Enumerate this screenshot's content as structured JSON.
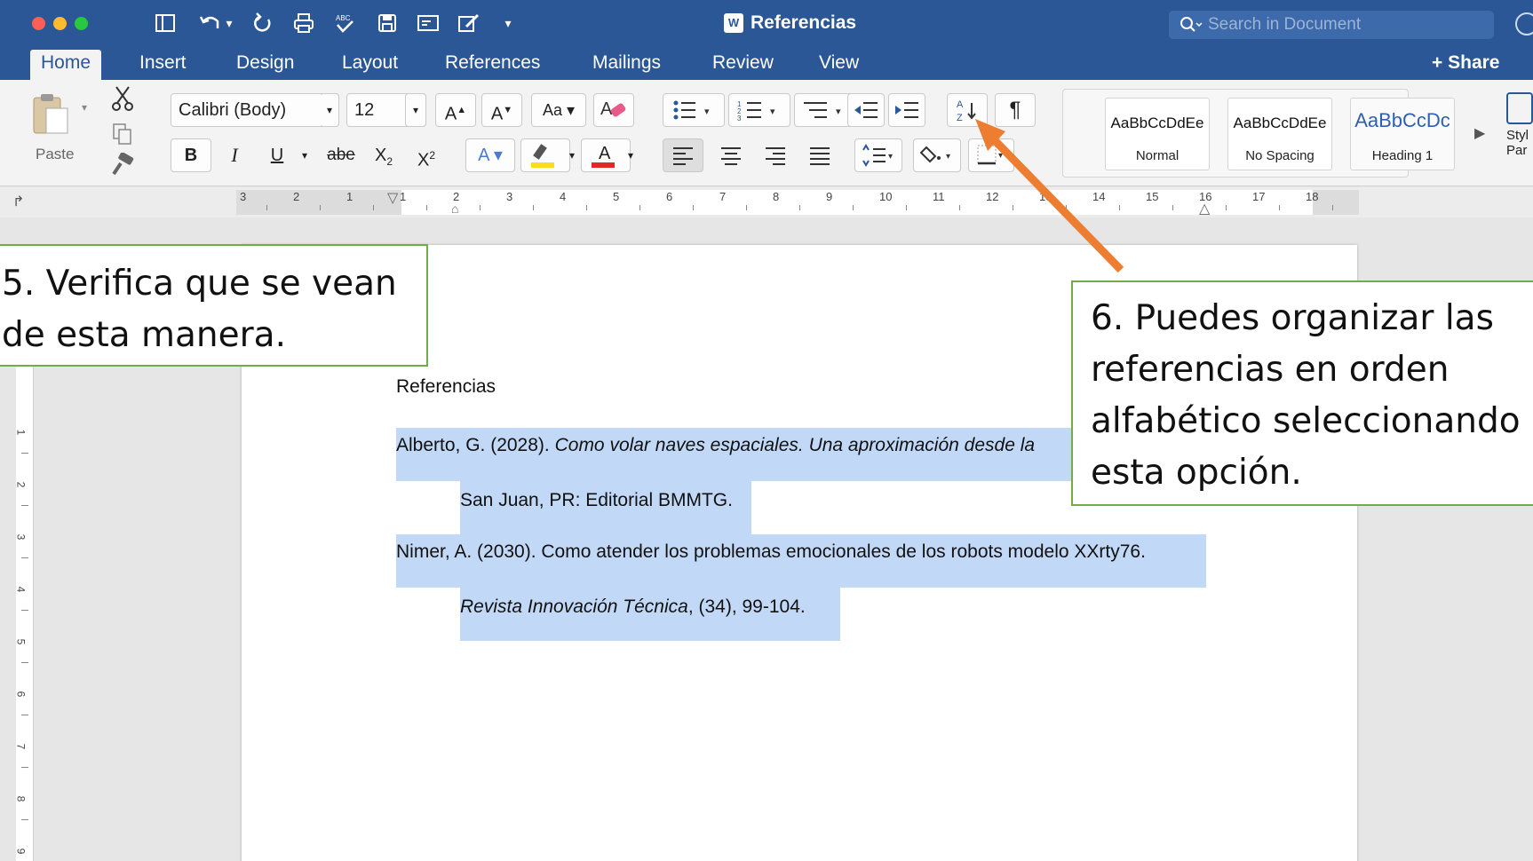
{
  "window": {
    "title": "Referencias",
    "doc_icon_letter": "W",
    "search_placeholder": "Search in Document",
    "share_label": "Share"
  },
  "quick_access": {
    "undo_arrow": "▾",
    "customize": "▾"
  },
  "tabs": [
    "Home",
    "Insert",
    "Design",
    "Layout",
    "References",
    "Mailings",
    "Review",
    "View"
  ],
  "ribbon": {
    "paste_label": "Paste",
    "font_name": "Calibri (Body)",
    "font_size": "12",
    "grow_font": "A",
    "shrink_font": "A",
    "bold": "B",
    "italic": "I",
    "underline": "U",
    "strikethrough": "abe",
    "subscript": "X",
    "subscript_mark": "2",
    "superscript": "X",
    "superscript_mark": "2",
    "font_color_letter": "A",
    "pilcrow": "¶",
    "sort_top": "A",
    "sort_bottom": "Z",
    "accent_red": "#e32626",
    "accent_yellow": "#f5e11b",
    "styles": [
      {
        "sample": "AaBbCcDdEe",
        "name": "Normal"
      },
      {
        "sample": "AaBbCcDdEe",
        "name": "No Spacing"
      },
      {
        "sample": "AaBbCcDc",
        "name": "Heading 1"
      }
    ],
    "styles_pane_label": "Styl Par"
  },
  "ruler": {
    "labels": [
      "3",
      "2",
      "1",
      "1",
      "2",
      "3",
      "4",
      "5",
      "6",
      "7",
      "8",
      "9",
      "10",
      "11",
      "12",
      "13",
      "14",
      "15",
      "16",
      "17",
      "18"
    ],
    "vertical_labels": [
      "1",
      "2",
      "3",
      "4",
      "5",
      "6",
      "7",
      "8",
      "9"
    ]
  },
  "document": {
    "heading": "Referencias",
    "ref1_line1_plain": "Alberto, G. (2028). ",
    "ref1_line1_italic": "Como volar naves espaciales. Una aproximación desde la",
    "ref1_line2": "San Juan, PR: Editorial BMMTG.",
    "ref2_line1": "Nimer, A. (2030). Como atender los problemas emocionales de los robots modelo XXrty76.",
    "ref2_line2_italic": "Revista Innovación Técnica",
    "ref2_line2_plain": ", (34), 99-104.",
    "selection_color": "#c2d8f7"
  },
  "annotations": {
    "step5": "5. Verifica que se vean de esta manera.",
    "step6": "6. Puedes organizar las referencias en orden alfabético seleccionando esta opción.",
    "arrow_color": "#ed7d31",
    "border_color": "#70ad47"
  }
}
